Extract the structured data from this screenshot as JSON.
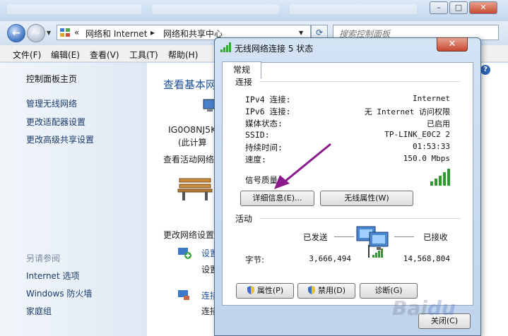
{
  "explorer": {
    "address": {
      "sep": "«",
      "crumb1": "网络和 Internet",
      "crumb2": "网络和共享中心"
    },
    "search_placeholder": "搜索控制面板",
    "menu": [
      "文件(F)",
      "编辑(E)",
      "查看(V)",
      "工具(T)",
      "帮助(H)"
    ],
    "sidebar": {
      "home": "控制面板主页",
      "links": [
        "管理无线网络",
        "更改适配器设置",
        "更改高级共享设置"
      ],
      "see_also": "另请参阅",
      "see_also_links": [
        "Internet 选项",
        "Windows 防火墙",
        "家庭组"
      ]
    },
    "content": {
      "title": "查看基本网",
      "computer_name": "IG0O8NJ5K",
      "computer_sub": "(此计算",
      "active_networks": "查看活动网络",
      "change_settings": "更改网络设置",
      "item1": "设置",
      "item1_sub": "设置",
      "item2": "连接",
      "item2_sub": "连接"
    }
  },
  "dialog": {
    "title": "无线网络连接 5 状态",
    "close_glyph": "✕",
    "tab": "常规",
    "connection_group": "连接",
    "rows": [
      {
        "label": "IPv4 连接:",
        "value": "Internet"
      },
      {
        "label": "IPv6 连接:",
        "value": "无 Internet 访问权限"
      },
      {
        "label": "媒体状态:",
        "value": "已启用"
      },
      {
        "label": "SSID:",
        "value": "TP-LINK_E0C2 2"
      },
      {
        "label": "持续时间:",
        "value": "01:53:33"
      },
      {
        "label": "速度:",
        "value": "150.0 Mbps"
      }
    ],
    "signal_label": "信号质量",
    "details_button": "详细信息(E)...",
    "wireless_props_button": "无线属性(W)",
    "activity_group": "活动",
    "sent_label": "已发送",
    "received_label": "已接收",
    "bytes_label": "字节:",
    "bytes_sent": "3,666,494",
    "bytes_received": "14,568,804",
    "properties_button": "属性(P)",
    "disable_button": "禁用(D)",
    "diagnose_button": "诊断(G)",
    "close_button": "关闭(C)"
  },
  "colors": {
    "accent": "#1b4f9e",
    "signal": "#3aa53a",
    "arrow": "#8a1a8c"
  }
}
